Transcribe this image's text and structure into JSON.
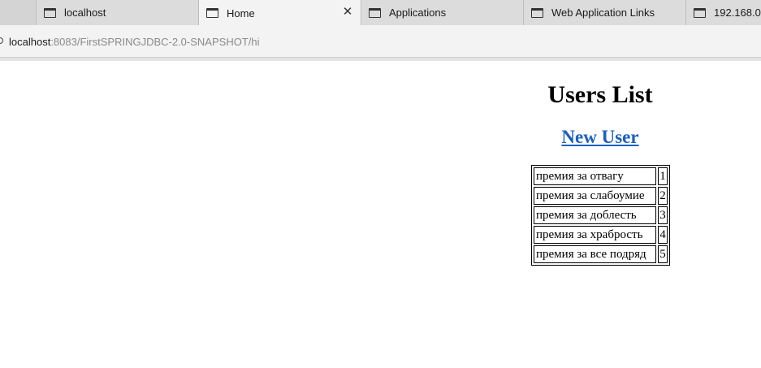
{
  "browser": {
    "tabs": [
      {
        "label": "localhost",
        "icon": "page-icon"
      },
      {
        "label": "Home",
        "icon": "page-icon",
        "active": true,
        "close_glyph": "✕"
      },
      {
        "label": "Applications",
        "icon": "page-icon"
      },
      {
        "label": "Web Application Links",
        "icon": "page-icon"
      },
      {
        "label": "192.168.0.",
        "icon": "page-icon"
      }
    ],
    "url_host": "localhost",
    "url_path": ":8083/FirstSPRINGJDBC-2.0-SNAPSHOT/hi"
  },
  "page": {
    "title": "Users List",
    "new_user_link": "New User",
    "rows": [
      {
        "name": "премия за отвагу",
        "id": "1"
      },
      {
        "name": "премия за слабоумие",
        "id": "2"
      },
      {
        "name": "премия за доблесть",
        "id": "3"
      },
      {
        "name": "премия за храбрость",
        "id": "4"
      },
      {
        "name": "премия за все подряд",
        "id": "5"
      }
    ]
  },
  "colors": {
    "link": "#1c5fbf",
    "tabstrip": "#d8d8d8",
    "active_tab": "#f3f3f3"
  }
}
